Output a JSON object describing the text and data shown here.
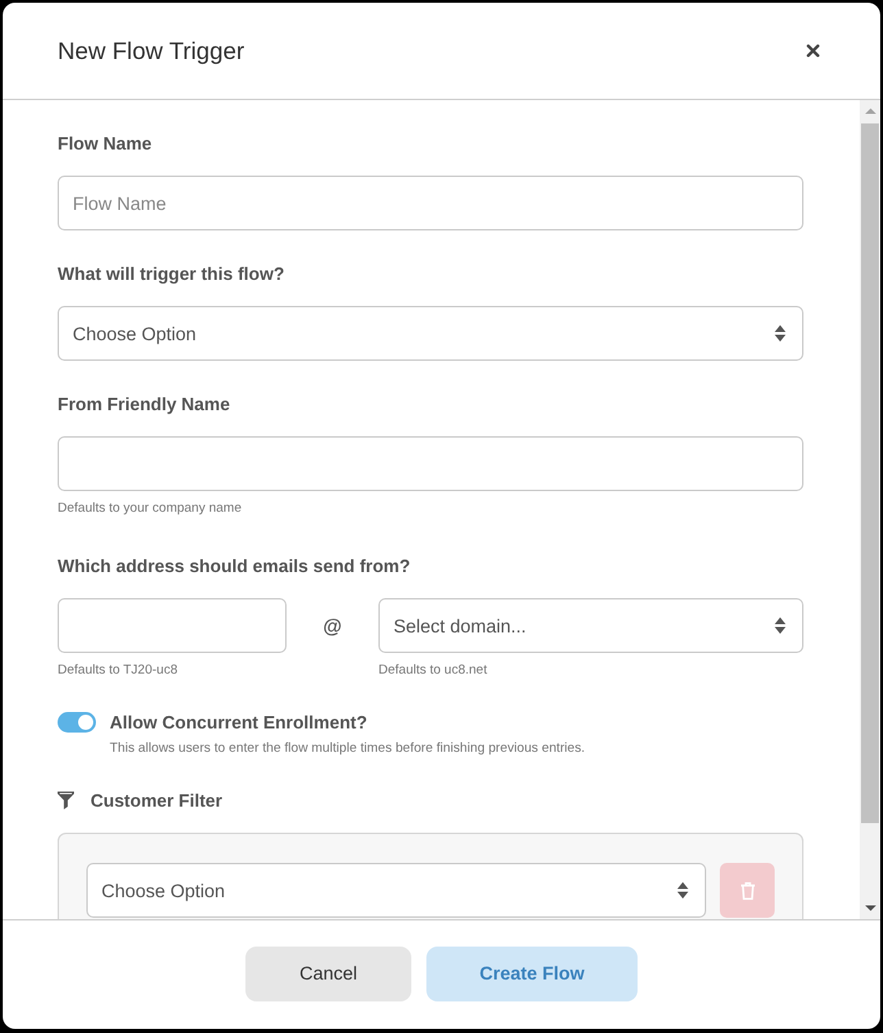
{
  "dialog": {
    "title": "New Flow Trigger"
  },
  "fields": [
    {
      "kind": "text",
      "label": "Flow Name",
      "placeholder": "Flow Name"
    },
    {
      "kind": "select",
      "label": "What will trigger this flow?",
      "value": "Choose Option"
    },
    {
      "kind": "text",
      "label": "From Friendly Name",
      "hint": "Defaults to your company name"
    },
    {
      "kind": "address",
      "label": "Which address should emails send from?",
      "local": {
        "hint": "Defaults to TJ20-uc8"
      },
      "separator": "@",
      "domain": {
        "value": "Select domain...",
        "hint": "Defaults to uc8.net"
      }
    },
    {
      "kind": "toggle",
      "label": "Allow Concurrent Enrollment?",
      "on": true,
      "description": "This allows users to enter the flow multiple times before finishing previous entries."
    },
    {
      "kind": "filter",
      "label": "Customer Filter",
      "select": {
        "value": "Choose Option"
      },
      "delete_disabled": true
    }
  ],
  "footer": {
    "buttons": [
      {
        "kind": "secondary",
        "label": "Cancel",
        "disabled": false
      },
      {
        "kind": "primary",
        "label": "Create Flow",
        "disabled": true
      }
    ]
  }
}
